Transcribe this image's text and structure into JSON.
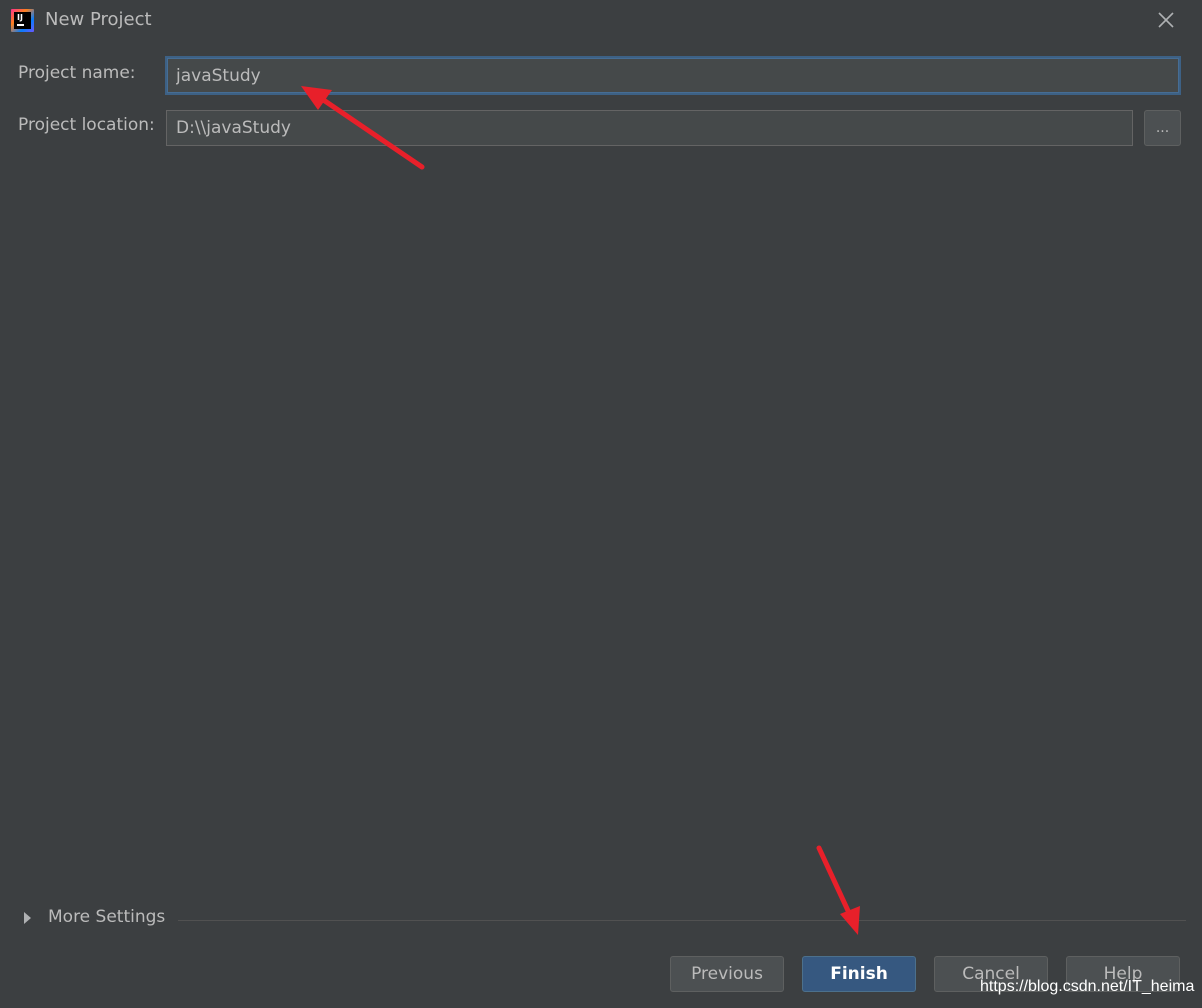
{
  "window": {
    "title": "New Project",
    "app_icon": "intellij-idea-icon",
    "close_icon": "close-icon"
  },
  "form": {
    "project_name_label": "Project name:",
    "project_name_value": "javaStudy",
    "project_location_label": "Project location:",
    "project_location_value": "D:\\\\javaStudy",
    "browse_label": "..."
  },
  "more_settings": {
    "label": "More Settings",
    "icon": "triangle-right-icon"
  },
  "buttons": {
    "previous": "Previous",
    "finish": "Finish",
    "cancel": "Cancel",
    "help": "Help"
  },
  "annotations": {
    "arrow_color": "#e8202a",
    "watermark": "https://blog.csdn.net/IT_heima"
  },
  "colors": {
    "background": "#3c3f41",
    "input_background": "#45494a",
    "focus_border": "#3d6185",
    "default_button": "#365880",
    "text": "#bbbbbb"
  }
}
